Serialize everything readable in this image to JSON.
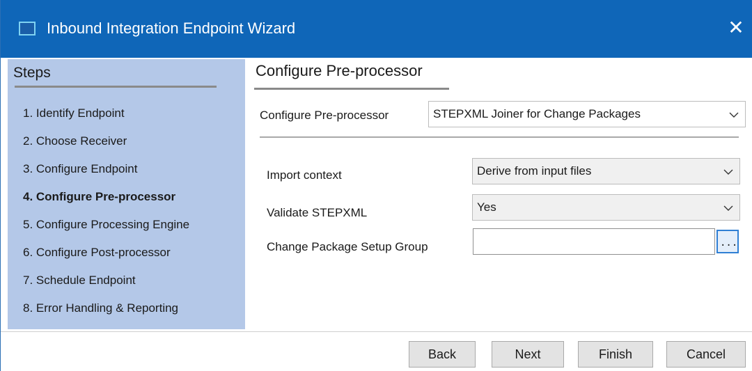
{
  "window": {
    "title": "Inbound Integration Endpoint Wizard",
    "close_glyph": "✕",
    "icon": "window-app-icon"
  },
  "steps": {
    "heading": "Steps",
    "items": [
      {
        "label": "1. Identify Endpoint",
        "current": false
      },
      {
        "label": "2. Choose Receiver",
        "current": false
      },
      {
        "label": "3. Configure Endpoint",
        "current": false
      },
      {
        "label": "4. Configure Pre-processor",
        "current": true
      },
      {
        "label": "5. Configure Processing Engine",
        "current": false
      },
      {
        "label": "6. Configure Post-processor",
        "current": false
      },
      {
        "label": "7. Schedule Endpoint",
        "current": false
      },
      {
        "label": "8. Error Handling & Reporting",
        "current": false
      }
    ]
  },
  "content": {
    "heading": "Configure Pre-processor",
    "preprocessor": {
      "label": "Configure Pre-processor",
      "value": "STEPXML Joiner for Change Packages"
    },
    "import_context": {
      "label": "Import context",
      "value": "Derive from input files"
    },
    "validate_stepxml": {
      "label": "Validate STEPXML",
      "value": "Yes"
    },
    "change_package_setup_group": {
      "label": "Change Package Setup Group",
      "value": "",
      "browse_label": "..."
    }
  },
  "buttons": {
    "back": "Back",
    "next": "Next",
    "finish": "Finish",
    "cancel": "Cancel"
  },
  "colors": {
    "titlebar": "#0f66b8",
    "steps_panel": "#b4c8e8",
    "browse_border": "#2f7fd4"
  }
}
